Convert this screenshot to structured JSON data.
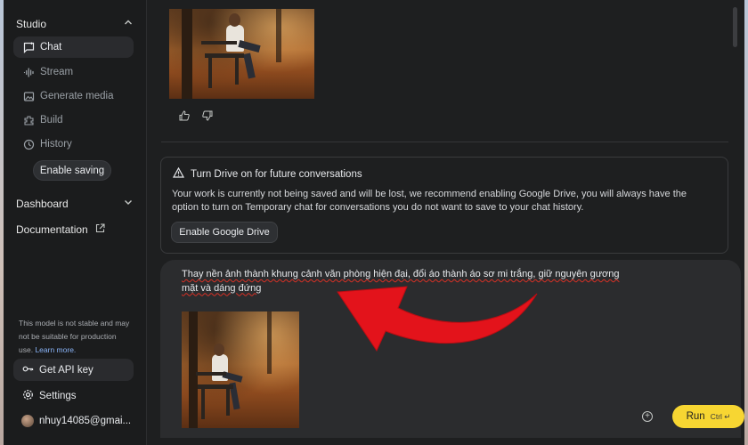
{
  "sidebar": {
    "studio_label": "Studio",
    "items": [
      {
        "label": "Chat",
        "icon": "chat-icon",
        "active": true
      },
      {
        "label": "Stream",
        "icon": "stream-icon",
        "active": false
      },
      {
        "label": "Generate media",
        "icon": "media-icon",
        "active": false
      },
      {
        "label": "Build",
        "icon": "build-icon",
        "active": false
      },
      {
        "label": "History",
        "icon": "history-icon",
        "active": false
      }
    ],
    "enable_saving_label": "Enable saving",
    "dashboard_label": "Dashboard",
    "documentation_label": "Documentation",
    "note_text": "This model is not stable and may not be suitable for production use.",
    "note_link": "Learn more.",
    "api_key_label": "Get API key",
    "settings_label": "Settings",
    "user_email": "nhuy14085@gmai..."
  },
  "drive_notice": {
    "title": "Turn Drive on for future conversations",
    "body": "Your work is currently not being saved and will be lost, we recommend enabling Google Drive, you will always have the option to turn on Temporary chat for conversations you do not want to save to your chat history.",
    "button_label": "Enable Google Drive"
  },
  "composer": {
    "prompt_text": "Thay nền ảnh thành khung cảnh văn phòng hiện đại, đổi áo thành áo sơ mi trắng, giữ nguyên gương mặt và dáng đứng",
    "run_label": "Run",
    "run_shortcut": "Ctrl ↵"
  },
  "colors": {
    "accent_run": "#f7d632",
    "annotation_arrow": "#e3131b",
    "background": "#1e1f20"
  }
}
